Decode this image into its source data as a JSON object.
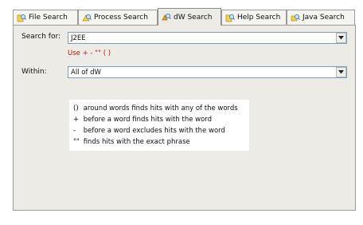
{
  "tabs": [
    {
      "label": "File Search",
      "icon": "file-search-icon",
      "active": false
    },
    {
      "label": "Process Search",
      "icon": "process-search-icon",
      "active": false
    },
    {
      "label": "dW Search",
      "icon": "dw-search-icon",
      "active": true
    },
    {
      "label": "Help Search",
      "icon": "help-search-icon",
      "active": false
    },
    {
      "label": "Java Search",
      "icon": "java-search-icon",
      "active": false
    }
  ],
  "search": {
    "label": "Search for:",
    "value": "J2EE",
    "hint": "Use + - \"\" ( )"
  },
  "within": {
    "label": "Within:",
    "value": "All of dW"
  },
  "help": {
    "lines": [
      {
        "symbol": "()",
        "text": "around words finds hits with any of the words"
      },
      {
        "symbol": "+",
        "text": "before a word finds hits with the word"
      },
      {
        "symbol": "-",
        "text": "before a word excludes hits with the word"
      },
      {
        "symbol": "\"\"",
        "text": "finds hits with the exact phrase"
      }
    ]
  },
  "colors": {
    "hint": "#d01010",
    "panel": "#ecebe6",
    "icon_body": "#f2d44a",
    "icon_lens": "#6aa0d8"
  }
}
